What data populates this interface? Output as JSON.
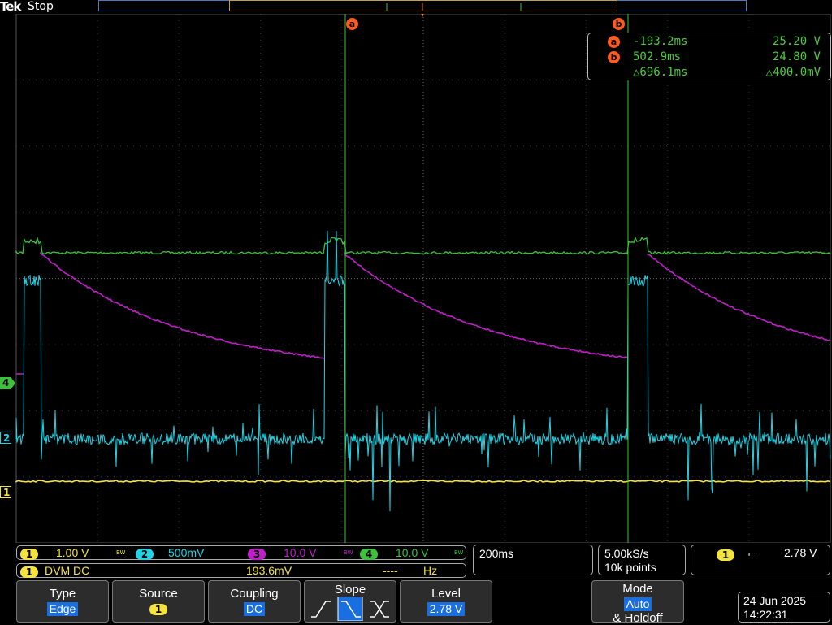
{
  "header": {
    "brand": "Tek",
    "acq_state": "Stop"
  },
  "cursors": {
    "a_label": "a",
    "b_label": "b",
    "a_time": "-193.2ms",
    "a_value": "25.20 V",
    "b_time": "502.9ms",
    "b_value": "24.80 V",
    "delta_time": "△696.1ms",
    "delta_value": "△400.0mV"
  },
  "channel_markers": {
    "ch4": "4",
    "ch2": "2",
    "ch1": "1"
  },
  "channels": [
    {
      "num": "1",
      "scale": "1.00 V",
      "bw": "BW",
      "color": "#f4e33c"
    },
    {
      "num": "2",
      "scale": "500mV",
      "color": "#22d3e6"
    },
    {
      "num": "3",
      "scale": "10.0 V",
      "bw": "BW",
      "color": "#c01fc8"
    },
    {
      "num": "4",
      "scale": "10.0 V",
      "bw": "BW",
      "color": "#3cc23c"
    }
  ],
  "dvm": {
    "num": "1",
    "mode": "DVM DC",
    "value": "193.6mV",
    "freq": "----",
    "freq_unit": "Hz"
  },
  "timebase": {
    "scale": "200ms"
  },
  "acquisition": {
    "rate": "5.00kS/s",
    "points": "10k points"
  },
  "trigger_readout": {
    "source": "1",
    "slope_symbol": "⌐",
    "level": "2.78 V"
  },
  "menu": {
    "type_label": "Type",
    "type_value": "Edge",
    "source_label": "Source",
    "source_value": "1",
    "coupling_label": "Coupling",
    "coupling_value": "DC",
    "slope_label": "Slope",
    "level_label": "Level",
    "level_value": "2.78 V",
    "mode_label": "Mode",
    "mode_value": "Auto",
    "mode_label2": "& Holdoff"
  },
  "datetime": {
    "date": "24 Jun 2025",
    "time": "14:22:31"
  },
  "colors": {
    "ch1": "#f4e33c",
    "ch2": "#22d3e6",
    "ch3": "#c01fc8",
    "ch4": "#3cc23c",
    "cursor": "#ff5a1f",
    "accent": "#1a6fe0"
  }
}
